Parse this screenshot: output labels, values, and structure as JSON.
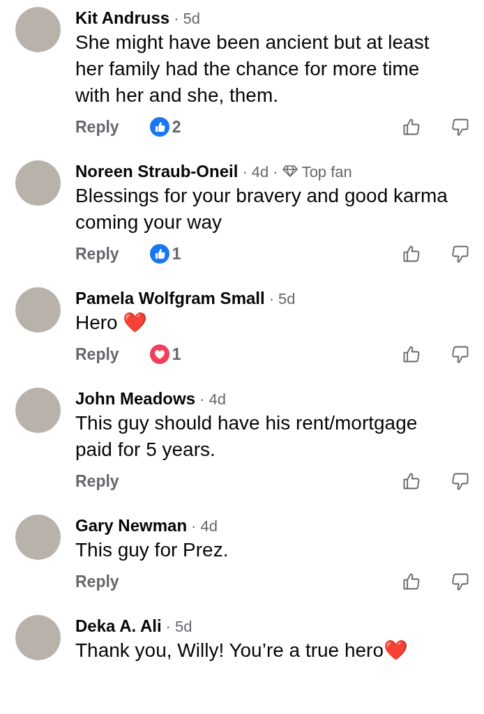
{
  "comments": [
    {
      "author": "Kit Andruss",
      "time": "· 5d",
      "text": "She might have been ancient but at least her family had the chance for more time with her and she, them.",
      "reply": "Reply",
      "reaction": {
        "kind": "like",
        "count": "2"
      }
    },
    {
      "author": "Noreen Straub-Oneil",
      "time": "· 4d",
      "badge": {
        "separator": "·",
        "label": "Top fan"
      },
      "text": "Blessings for your bravery and good karma coming your way",
      "reply": "Reply",
      "reaction": {
        "kind": "like",
        "count": "1"
      }
    },
    {
      "author": "Pamela Wolfgram Small",
      "time": "· 5d",
      "text": "Hero ❤️",
      "reply": "Reply",
      "reaction": {
        "kind": "love",
        "count": "1"
      }
    },
    {
      "author": "John Meadows",
      "time": "· 4d",
      "text": "This guy should have his rent/mortgage paid for 5 years.",
      "reply": "Reply"
    },
    {
      "author": "Gary Newman",
      "time": "· 4d",
      "text": "This guy for Prez.",
      "reply": "Reply"
    },
    {
      "author": "Deka A. Ali",
      "time": "· 5d",
      "text": "Thank you, Willy! You’re a true hero❤️"
    }
  ]
}
